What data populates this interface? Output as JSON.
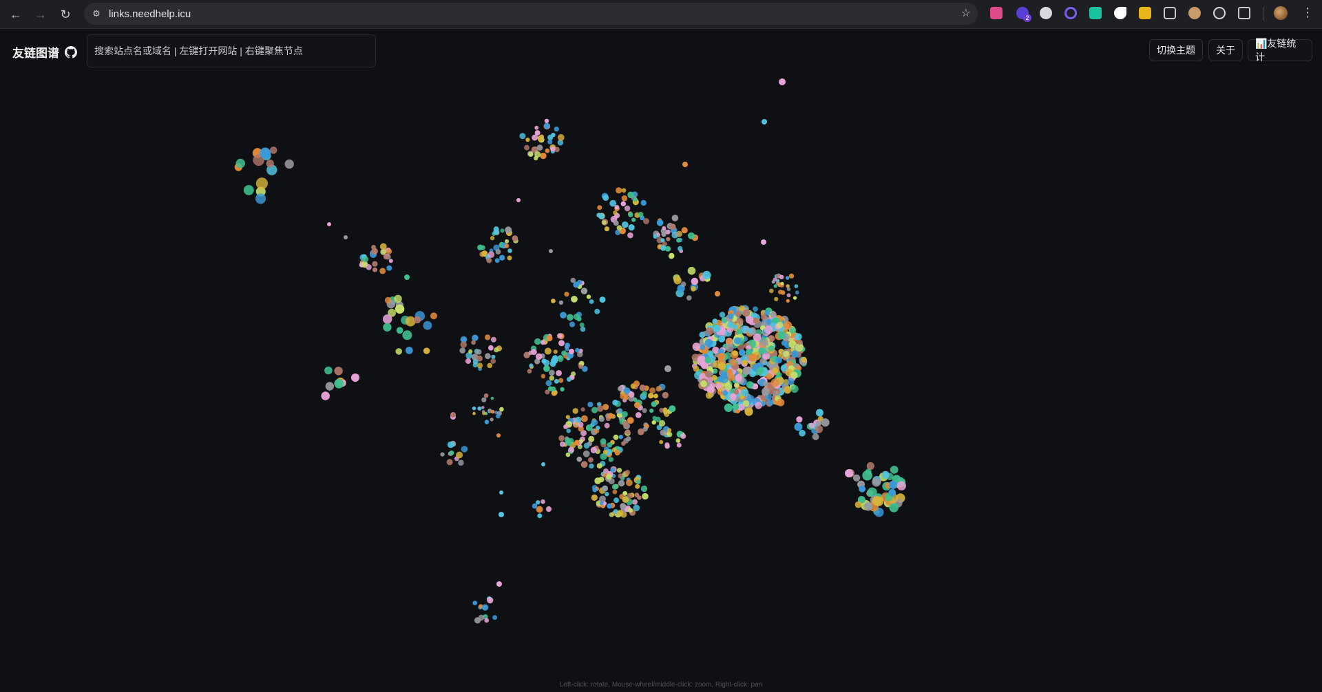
{
  "browser": {
    "url": "links.needhelp.icu",
    "back_icon": "arrow-left-icon",
    "forward_icon": "arrow-right-icon",
    "reload_icon": "reload-icon",
    "site_info_icon": "tune-icon",
    "bookmark_icon": "star-icon",
    "extension_badge": "2",
    "menu_icon": "more-vert-icon"
  },
  "app": {
    "title": "友链图谱",
    "github_icon": "github-icon",
    "search_placeholder": "搜索站点名或域名 | 左键打开网站 | 右键聚焦节点",
    "buttons": {
      "theme": "切换主题",
      "about": "关于",
      "stats": "📊友链统计"
    },
    "hint": "Left-click: rotate, Mouse-wheel/middle-click: zoom, Right-click: pan"
  },
  "colors": {
    "background": "#0f1013",
    "node_palette": [
      "#4fc3e0",
      "#3a9ad9",
      "#e08a3a",
      "#e7a3d6",
      "#d7b33a",
      "#3fbf8f",
      "#9a9aa0",
      "#c7e06a",
      "#b0776a"
    ]
  }
}
